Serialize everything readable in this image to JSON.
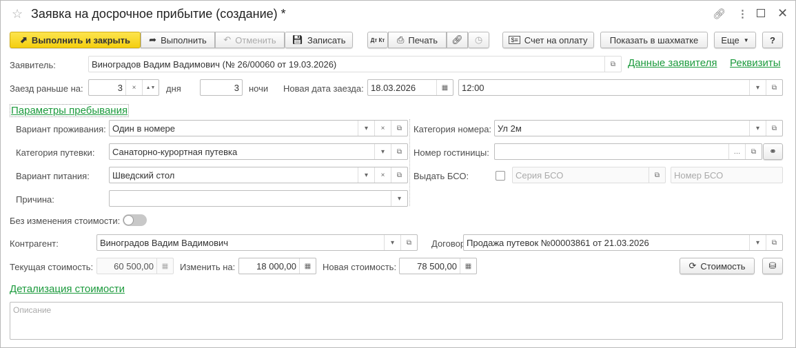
{
  "window": {
    "title": "Заявка на досрочное прибытие (создание) *"
  },
  "toolbar": {
    "run_close": "Выполнить и закрыть",
    "run": "Выполнить",
    "cancel": "Отменить",
    "save": "Записать",
    "dtkt": "Дт Кт",
    "print": "Печать",
    "invoice": "Счет на оплату",
    "chess": "Показать в шахматке",
    "more": "Еще",
    "help": "?"
  },
  "applicant": {
    "label": "Заявитель:",
    "value": "Виноградов Вадим Вадимович (№ 26/00060 от 19.03.2026)",
    "link_data": "Данные заявителя",
    "link_req": "Реквизиты"
  },
  "arrival": {
    "label": "Заезд раньше на:",
    "days": "3",
    "days_unit": "дня",
    "nights": "3",
    "nights_unit": "ночи",
    "new_date_label": "Новая дата заезда:",
    "new_date": "18.03.2026",
    "time": "12:00"
  },
  "stay": {
    "section": "Параметры пребывания",
    "accommodation_label": "Вариант проживания:",
    "accommodation": "Один в номере",
    "voucher_label": "Категория путевки:",
    "voucher": "Санаторно-курортная путевка",
    "meal_label": "Вариант питания:",
    "meal": "Шведский стол",
    "reason_label": "Причина:",
    "reason": "",
    "room_cat_label": "Категория номера:",
    "room_cat": "Ул 2м",
    "room_no_label": "Номер гостиницы:",
    "room_no": "",
    "bso_label": "Выдать БСО:",
    "bso_series_ph": "Серия БСО",
    "bso_number_ph": "Номер БСО"
  },
  "cost": {
    "no_change_label": "Без изменения стоимости:",
    "no_change": false,
    "contractor_label": "Контрагент:",
    "contractor": "Виноградов Вадим Вадимович",
    "contract_label": "Договор:",
    "contract": "Продажа путевок №00003861 от 21.03.2026",
    "current_label": "Текущая стоимость:",
    "current": "60 500,00",
    "change_label": "Изменить на:",
    "change": "18 000,00",
    "new_label": "Новая стоимость:",
    "new": "78 500,00",
    "cost_button": "Стоимость",
    "detail_link": "Детализация стоимости"
  },
  "description": {
    "placeholder": "Описание"
  }
}
